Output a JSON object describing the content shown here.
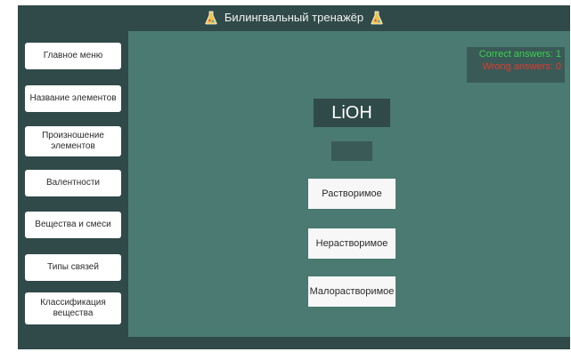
{
  "app": {
    "title": "Билингвальный тренажёр",
    "icon_left": "flask-icon",
    "icon_right": "flask-icon"
  },
  "sidebar": {
    "items": [
      {
        "label": "Главное меню"
      },
      {
        "label": "Название элементов"
      },
      {
        "label": "Произношение элементов"
      },
      {
        "label": "Валентности"
      },
      {
        "label": "Вещества и смеси"
      },
      {
        "label": "Типы связей"
      },
      {
        "label": "Классификация вещества"
      }
    ]
  },
  "score": {
    "correct": "Correct answers: 1",
    "wrong": "Wrong answers: 0"
  },
  "quiz": {
    "formula": "LiOH",
    "answer": "",
    "options": [
      "Растворимое",
      "Нерастворимое",
      "Малорастворимое"
    ]
  },
  "colors": {
    "frame": "#2f4a48",
    "panel": "#4a7a71",
    "correct": "#38d34b",
    "wrong": "#e23a2c"
  }
}
